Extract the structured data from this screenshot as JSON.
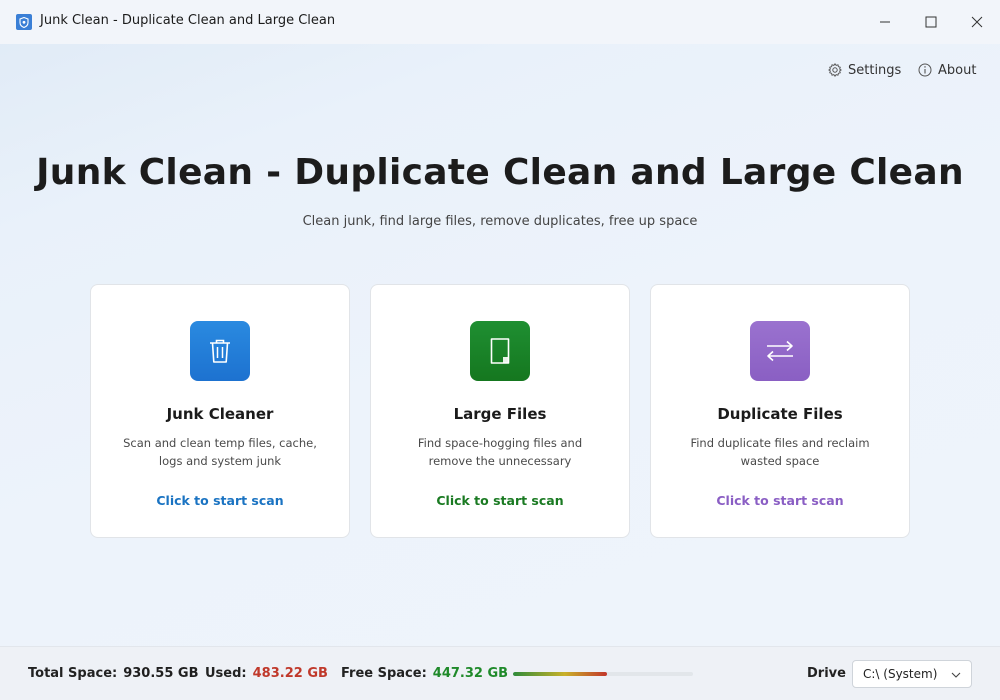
{
  "window": {
    "title": "Junk Clean - Duplicate Clean and Large Clean",
    "icon": "shield-icon"
  },
  "top_links": {
    "settings": "Settings",
    "about": "About"
  },
  "hero": {
    "title": "Junk Clean - Duplicate Clean and Large Clean",
    "subtitle": "Clean junk, find large files, remove duplicates, free up space"
  },
  "cards": [
    {
      "title": "Junk Cleaner",
      "description": "Scan and clean temp files, cache, logs and system junk",
      "action": "Click to start scan",
      "icon": "trash-icon",
      "color": "#1d72d0"
    },
    {
      "title": "Large Files",
      "description": "Find space-hogging files and remove the unnecessary",
      "action": "Click to start scan",
      "icon": "file-icon",
      "color": "#15771f"
    },
    {
      "title": "Duplicate Files",
      "description": "Find duplicate files and reclaim wasted space",
      "action": "Click to start scan",
      "icon": "swap-arrows-icon",
      "color": "#8a5fc3"
    }
  ],
  "status": {
    "total_label": "Total Space:",
    "total_value": "930.55 GB",
    "used_label": "Used:",
    "used_value": "483.22 GB",
    "free_label": "Free Space:",
    "free_value": "447.32 GB",
    "usage_fraction": 0.52,
    "drive_label": "Drive",
    "drive_selected": "C:\\ (System)"
  },
  "colors": {
    "used": "#c0392b",
    "free": "#1f8a2a",
    "accent_blue": "#1a73c2"
  }
}
